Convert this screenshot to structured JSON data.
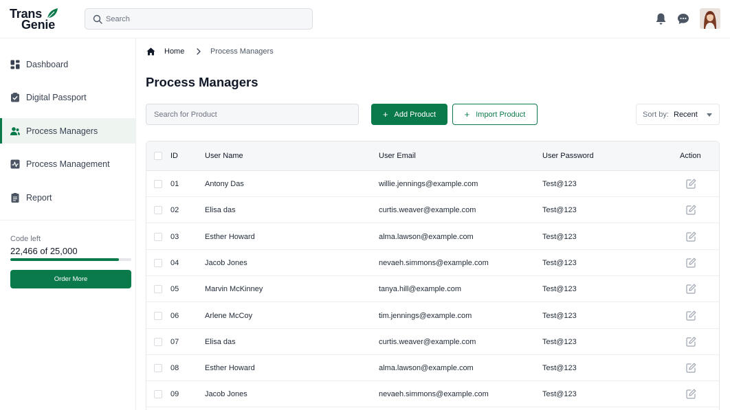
{
  "brand": {
    "line1": "Trans",
    "line2": "Genie",
    "accent": "#0b7a4b"
  },
  "header": {
    "search_placeholder": "Search",
    "icons": [
      "bell-icon",
      "chat-icon",
      "avatar"
    ]
  },
  "sidebar": {
    "items": [
      {
        "label": "Dashboard",
        "icon": "grid-icon",
        "active": false
      },
      {
        "label": "Digital Passport",
        "icon": "badge-check-icon",
        "active": false
      },
      {
        "label": "Process Managers",
        "icon": "users-icon",
        "active": true
      },
      {
        "label": "Process Management",
        "icon": "activity-icon",
        "active": false
      },
      {
        "label": "Report",
        "icon": "document-icon",
        "active": false
      }
    ],
    "code_left_label": "Code left",
    "code_left_value": "22,466 of 25,000",
    "code_progress": 0.8986,
    "order_label": "Order More"
  },
  "breadcrumb": {
    "home": "Home",
    "current": "Process Managers"
  },
  "page_title": "Process Managers",
  "toolbar": {
    "search_placeholder": "Search for Product",
    "add_label": "Add Product",
    "import_label": "Import Product",
    "sort_label": "Sort by:",
    "sort_value": "Recent"
  },
  "table": {
    "columns": {
      "id": "ID",
      "name": "User Name",
      "email": "User Email",
      "password": "User Password",
      "action": "Action"
    },
    "rows": [
      {
        "id": "01",
        "name": "Antony Das",
        "email": "willie.jennings@example.com",
        "password": "Test@123"
      },
      {
        "id": "02",
        "name": "Elisa das",
        "email": "curtis.weaver@example.com",
        "password": "Test@123"
      },
      {
        "id": "03",
        "name": "Esther Howard",
        "email": "alma.lawson@example.com",
        "password": "Test@123"
      },
      {
        "id": "04",
        "name": "Jacob Jones",
        "email": "nevaeh.simmons@example.com",
        "password": "Test@123"
      },
      {
        "id": "05",
        "name": "Marvin McKinney",
        "email": "tanya.hill@example.com",
        "password": "Test@123"
      },
      {
        "id": "06",
        "name": "Arlene McCoy",
        "email": "tim.jennings@example.com",
        "password": "Test@123"
      },
      {
        "id": "07",
        "name": "Elisa das",
        "email": "curtis.weaver@example.com",
        "password": "Test@123"
      },
      {
        "id": "08",
        "name": "Esther Howard",
        "email": "alma.lawson@example.com",
        "password": "Test@123"
      },
      {
        "id": "09",
        "name": "Jacob Jones",
        "email": "nevaeh.simmons@example.com",
        "password": "Test@123"
      }
    ]
  }
}
